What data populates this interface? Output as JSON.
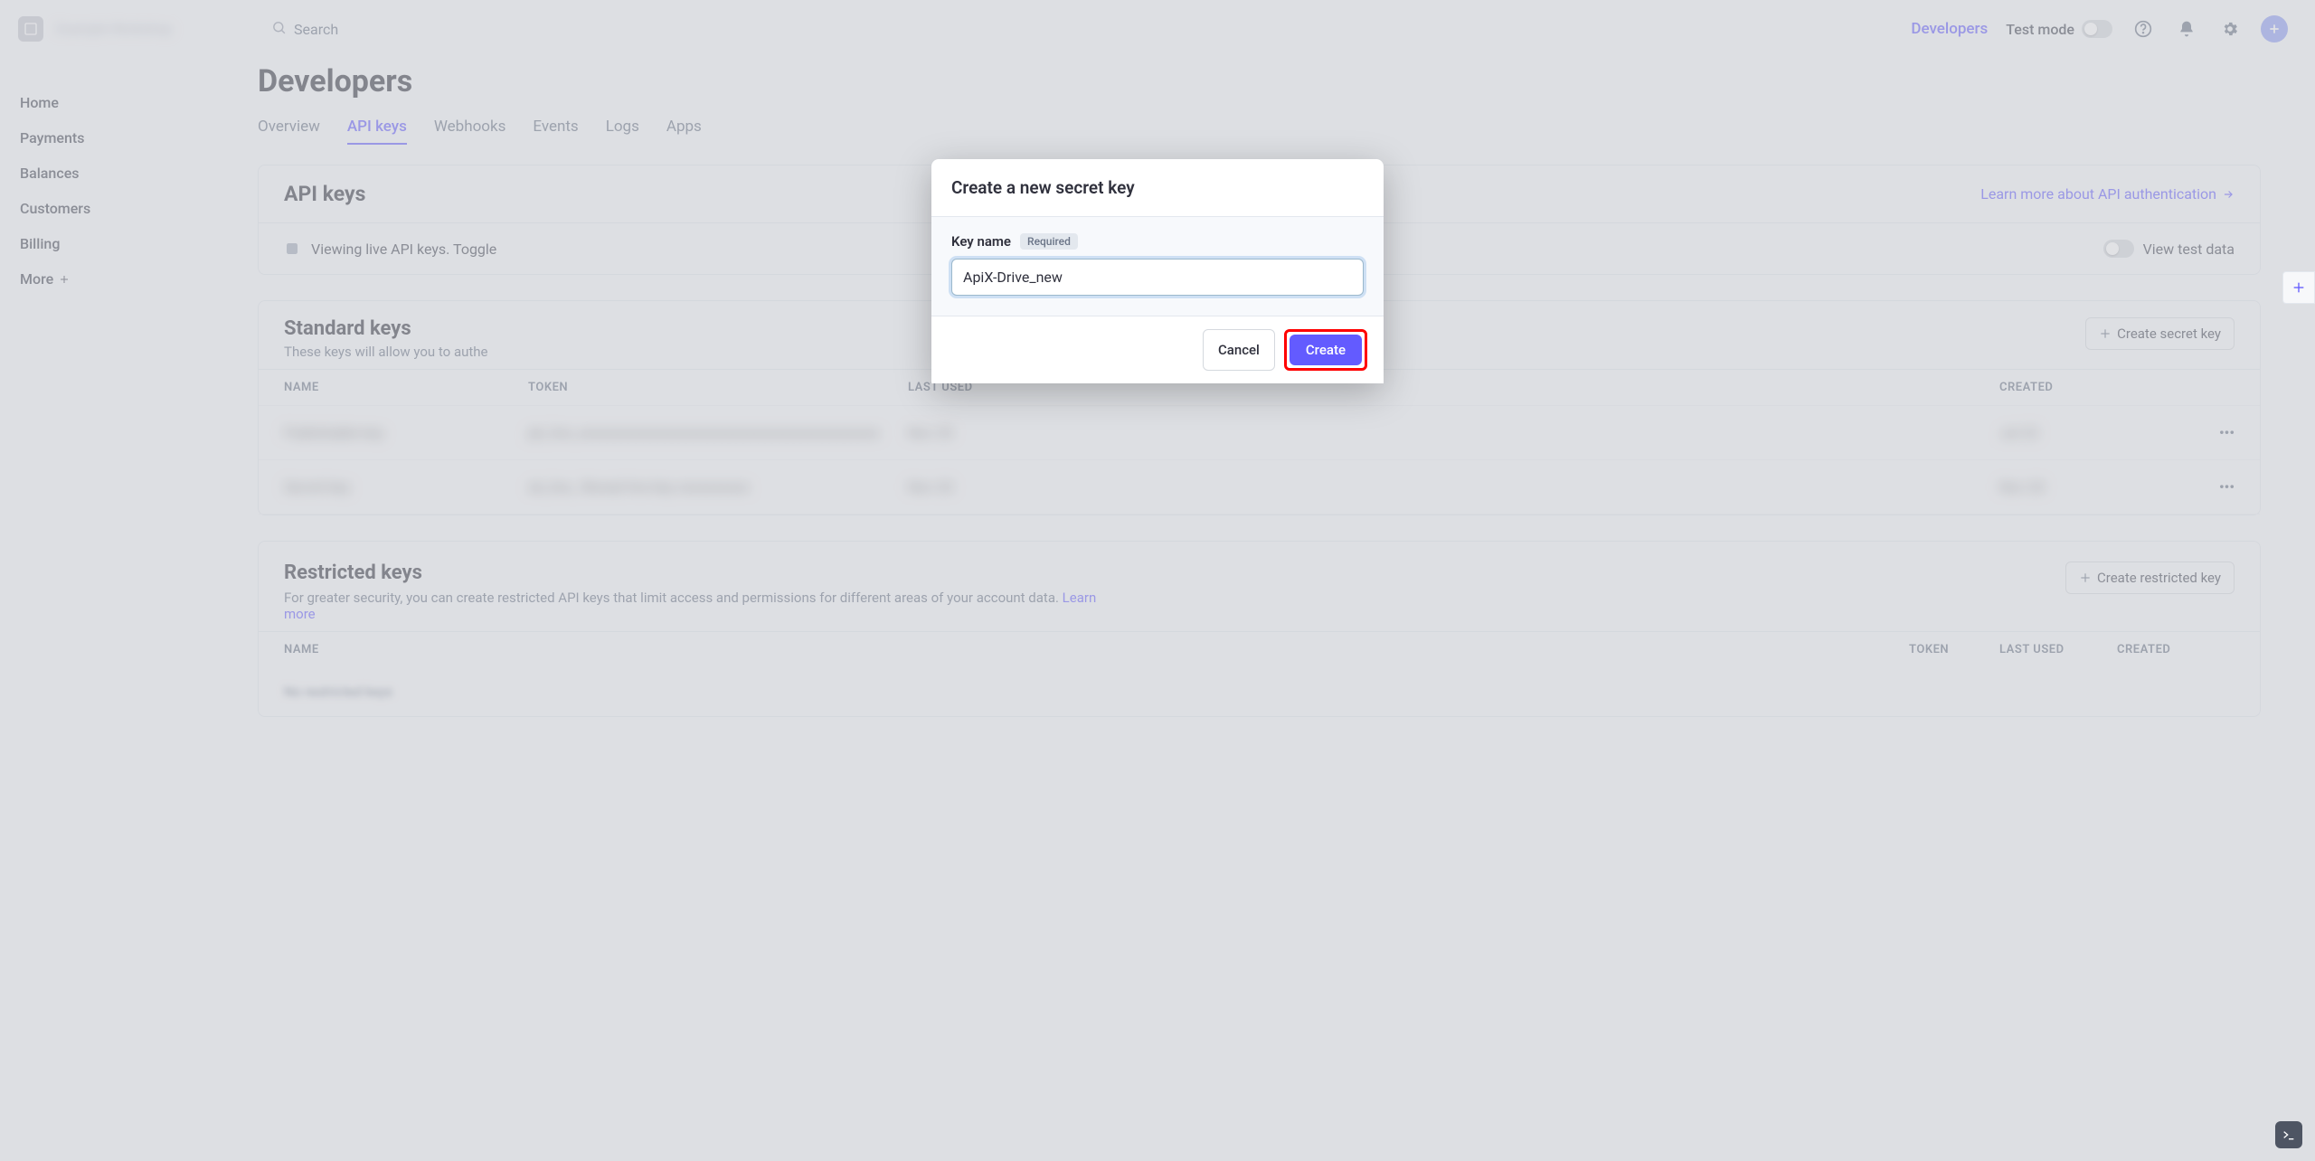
{
  "topbar": {
    "appName": "Example Workshop",
    "searchPlaceholder": "Search",
    "developersLink": "Developers",
    "testModeLabel": "Test mode",
    "avatarInitial": "+"
  },
  "sidebar": {
    "items": [
      "Home",
      "Payments",
      "Balances",
      "Customers",
      "Billing",
      "More"
    ]
  },
  "page": {
    "title": "Developers",
    "tabs": [
      "Overview",
      "API keys",
      "Webhooks",
      "Events",
      "Logs",
      "Apps"
    ],
    "activeTab": "API keys"
  },
  "apiKeysCard": {
    "heading": "API keys",
    "learnLink": "Learn more about API authentication",
    "infoText": "Viewing live API keys. Toggle",
    "viewTestData": "View test data"
  },
  "standardKeys": {
    "title": "Standard keys",
    "subtitle": "These keys will allow you to authe",
    "createBtn": "Create secret key",
    "columns": {
      "name": "NAME",
      "token": "TOKEN",
      "lastUsed": "LAST USED",
      "created": "CREATED"
    },
    "rows": [
      {
        "name": "Publishable key",
        "token": "pk_live_xxxxxxxxxxxxxxxxxxxxxxxxxxxxxxxxxxxxxxxxxx",
        "lastUsed": "Nov 20",
        "created": "Jul 22"
      },
      {
        "name": "Secret key",
        "token": "sk_live_ Reveal live key xxxxxxxxxx",
        "lastUsed": "Nov 20",
        "created": "Nov 20"
      }
    ]
  },
  "restrictedKeys": {
    "title": "Restricted keys",
    "subtitle": "For greater security, you can create restricted API keys that limit access and permissions for different areas of your account data. ",
    "learnMore": "Learn more",
    "createBtn": "Create restricted key",
    "columns": {
      "name": "NAME",
      "token": "TOKEN",
      "lastUsed": "LAST USED",
      "created": "CREATED"
    },
    "emptyText": "No restricted keys"
  },
  "modal": {
    "title": "Create a new secret key",
    "fieldLabel": "Key name",
    "requiredTag": "Required",
    "inputValue": "ApiX-Drive_new",
    "cancel": "Cancel",
    "create": "Create"
  }
}
